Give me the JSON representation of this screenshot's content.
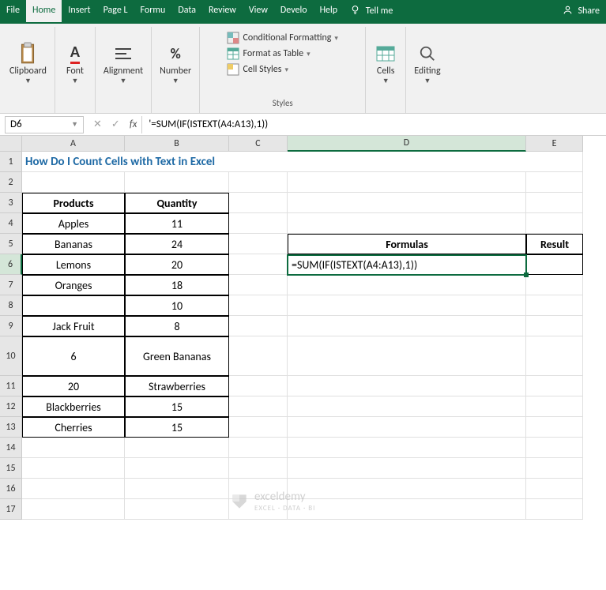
{
  "tabs": {
    "file": "File",
    "home": "Home",
    "insert": "Insert",
    "page": "Page L",
    "formu": "Formu",
    "data": "Data",
    "review": "Review",
    "view": "View",
    "devel": "Develo",
    "help": "Help",
    "tellme": "Tell me",
    "share": "Share"
  },
  "ribbon": {
    "clipboard": "Clipboard",
    "font": "Font",
    "alignment": "Alignment",
    "number": "Number",
    "styles": "Styles",
    "cells": "Cells",
    "editing": "Editing",
    "cond_fmt": "Conditional Formatting",
    "fmt_table": "Format as Table",
    "cell_styles": "Cell Styles"
  },
  "namebox": "D6",
  "formula": "'=SUM(IF(ISTEXT(A4:A13),1))",
  "cols": [
    "A",
    "B",
    "C",
    "D",
    "E"
  ],
  "rows": [
    "1",
    "2",
    "3",
    "4",
    "5",
    "6",
    "7",
    "8",
    "9",
    "10",
    "11",
    "12",
    "13",
    "14",
    "15",
    "16",
    "17"
  ],
  "sheet": {
    "title": "How Do I Count Cells with Text in Excel",
    "hdr_products": "Products",
    "hdr_qty": "Quantity",
    "a4": "Apples",
    "b4": "11",
    "a5": "Bananas",
    "b5": "24",
    "a6": "Lemons",
    "b6": "20",
    "a7": "Oranges",
    "b7": "18",
    "a8": "",
    "b8": "10",
    "a9": "Jack Fruit",
    "b9": "8",
    "a10": "6",
    "b10": "Green Bananas",
    "a11": "20",
    "b11": "Strawberries",
    "a12": "Blackberries",
    "b12": "15",
    "a13": "Cherries",
    "b13": "15",
    "d5": "Formulas",
    "e5": "Result",
    "d6": "=SUM(IF(ISTEXT(A4:A13),1))"
  },
  "watermark": {
    "brand": "exceldemy",
    "sub": "EXCEL · DATA · BI"
  }
}
